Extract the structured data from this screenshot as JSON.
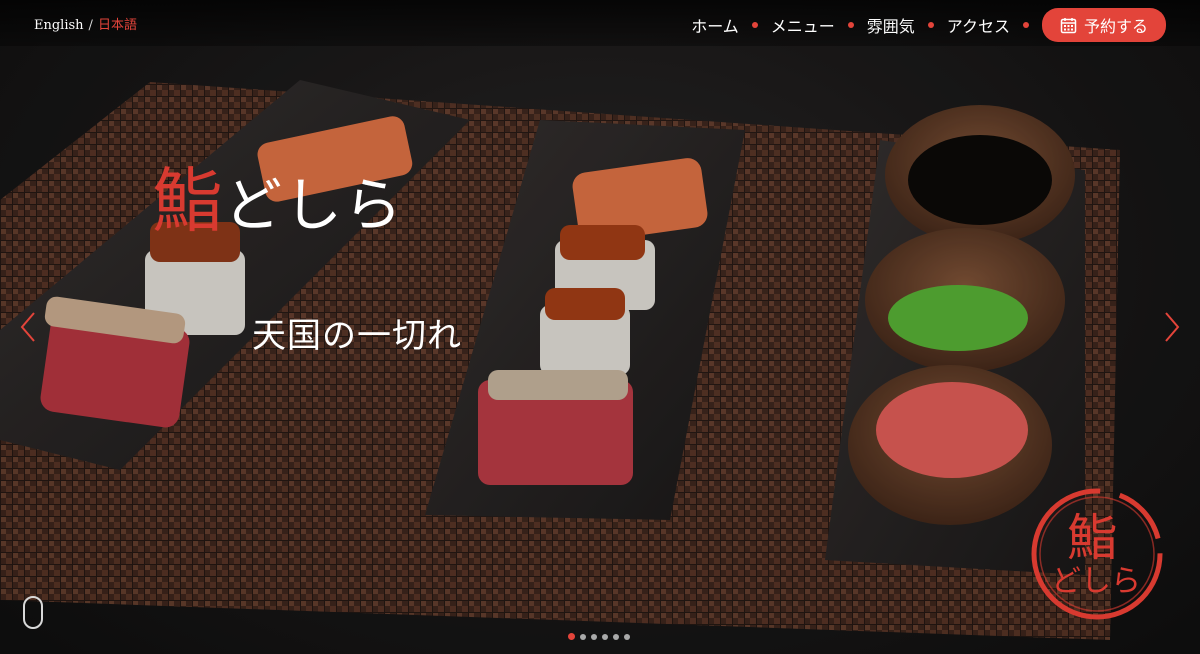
{
  "header": {
    "lang_en": "English",
    "lang_sep": "/",
    "lang_ja": "日本語",
    "nav": [
      "ホーム",
      "メニュー",
      "雰囲気",
      "アクセス"
    ],
    "reserve_label": "予約する",
    "reserve_icon": "calendar-icon"
  },
  "hero": {
    "title_kanji": "鮨",
    "title_kana": "どしら",
    "tagline": "天国の一切れ",
    "logo_kanji": "鮨",
    "logo_kana": "どしら"
  },
  "carousel": {
    "slide_count": 6,
    "active_index": 0
  },
  "colors": {
    "accent": "#e3443a",
    "title_red": "#d83a30",
    "background": "#1b1a1a"
  }
}
